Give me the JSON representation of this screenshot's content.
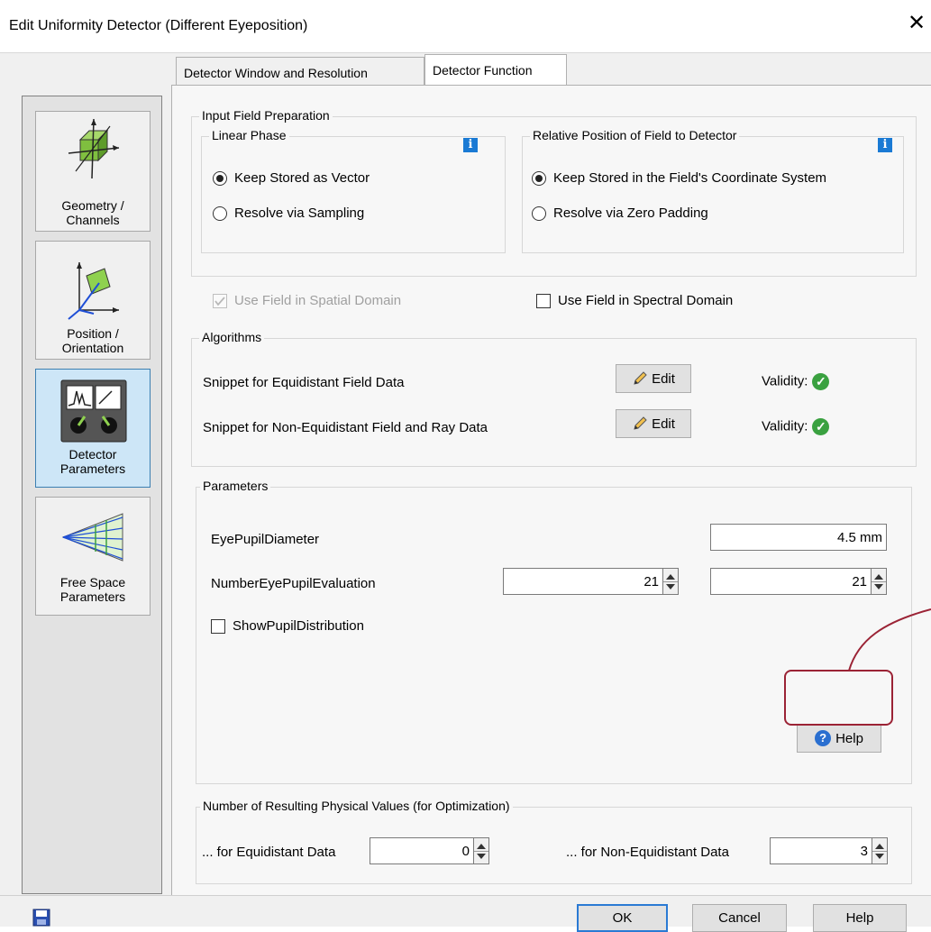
{
  "window": {
    "title": "Edit Uniformity Detector (Different Eyeposition)",
    "close_glyph": "✕"
  },
  "sidebar": {
    "items": [
      {
        "label_line1": "Geometry /",
        "label_line2": "Channels"
      },
      {
        "label_line1": "Position /",
        "label_line2": "Orientation"
      },
      {
        "label_line1": "Detector",
        "label_line2": "Parameters",
        "selected": true
      },
      {
        "label_line1": "Free Space",
        "label_line2": "Parameters"
      }
    ]
  },
  "tabs": [
    {
      "label": "Detector Window and Resolution"
    },
    {
      "label": "Detector Function",
      "active": true
    }
  ],
  "input_field_preparation": {
    "title": "Input Field Preparation",
    "linear_phase": {
      "title": "Linear Phase",
      "info_glyph": "i",
      "option1": "Keep Stored as Vector",
      "option2": "Resolve via Sampling"
    },
    "relative_position": {
      "title": "Relative Position of Field to Detector",
      "info_glyph": "i",
      "option1": "Keep Stored in the Field's Coordinate System",
      "option2": "Resolve via Zero Padding"
    }
  },
  "domain_options": {
    "spatial": "Use Field in Spatial Domain",
    "spectral": "Use Field in Spectral Domain"
  },
  "algorithms": {
    "title": "Algorithms",
    "rows": [
      {
        "label": "Snippet for Equidistant Field Data",
        "edit_label": "Edit",
        "validity_label": "Validity:"
      },
      {
        "label": "Snippet for Non-Equidistant Field and Ray Data",
        "edit_label": "Edit",
        "validity_label": "Validity:"
      }
    ],
    "check_glyph": "✓"
  },
  "parameters": {
    "title": "Parameters",
    "eye_pupil_diameter": {
      "label": "EyePupilDiameter",
      "value": "4.5 mm"
    },
    "number_eye_pupil_eval": {
      "label": "NumberEyePupilEvaluation",
      "value1": "21",
      "value2": "21"
    },
    "show_pupil_distribution": {
      "label": "ShowPupilDistribution"
    },
    "help_label": "Help",
    "help_glyph": "?"
  },
  "resulting_values": {
    "title": "Number of Resulting Physical Values (for Optimization)",
    "equidistant": {
      "label": "... for Equidistant Data",
      "value": "0"
    },
    "non_equidistant": {
      "label": "... for Non-Equidistant Data",
      "value": "3"
    }
  },
  "footer": {
    "ok": "OK",
    "cancel": "Cancel",
    "help": "Help"
  },
  "colors": {
    "accent": "#2a7ad4",
    "highlight": "#9b2335",
    "valid": "#3aa140",
    "selected_bg": "#cde6f7"
  }
}
